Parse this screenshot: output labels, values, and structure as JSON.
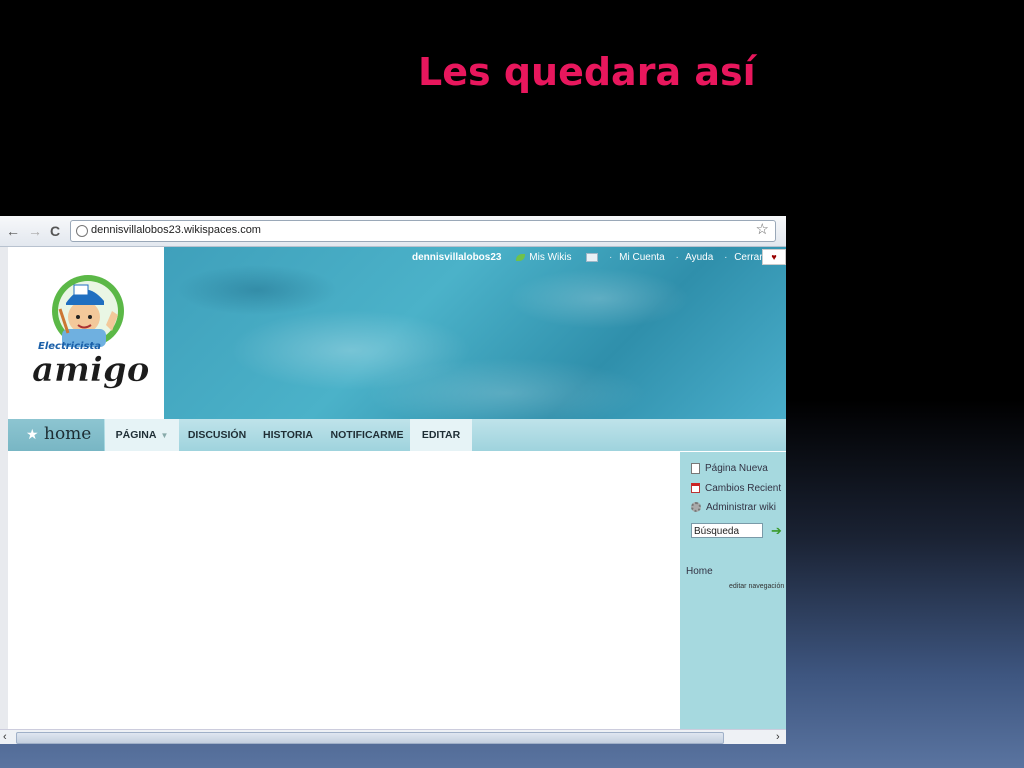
{
  "slide": {
    "title": "Les quedara así"
  },
  "browser": {
    "back_glyph": "←",
    "forward_glyph": "→",
    "reload_glyph": "C",
    "url": "dennisvillalobos23.wikispaces.com",
    "star_glyph": "☆"
  },
  "header": {
    "logo_text_top": "Electricista",
    "logo_text_main": "amigo",
    "username": "dennisvillalobos23",
    "links": {
      "mis_wikis": "Mis Wikis",
      "mi_cuenta": "Mi Cuenta",
      "ayuda": "Ayuda",
      "cerrar_sesion": "Cerrar Sesión"
    },
    "separator": "·"
  },
  "tabs": {
    "home": "home",
    "pagina": "PÁGINA",
    "discusion": "DISCUSIÓN",
    "historia": "HISTORIA",
    "notificarme": "NOTIFICARME",
    "editar": "EDITAR"
  },
  "sidebar": {
    "pagina_nueva": "Página Nueva",
    "cambios_recientes": "Cambios Recient",
    "administrar_wiki": "Administrar wiki",
    "search_value": "Búsqueda",
    "home_link": "Home",
    "editar_navegacion": "editar navegación"
  },
  "colors": {
    "title": "#e8175d",
    "header_water": "#3fa0bb",
    "sidebar_bg": "#a6d9df"
  }
}
